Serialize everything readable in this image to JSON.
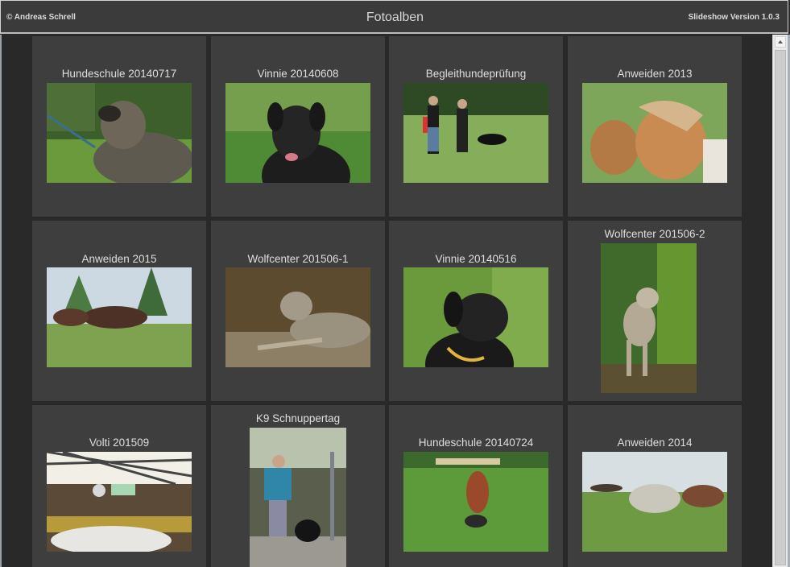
{
  "header": {
    "copyright": "© Andreas Schrell",
    "title": "Fotoalben",
    "version": "Slideshow Version 1.0.3"
  },
  "albums": [
    {
      "title": "Hundeschule 20140717",
      "icon": "dog-photo",
      "orientation": "landscape"
    },
    {
      "title": "Vinnie 20140608",
      "icon": "dog-photo",
      "orientation": "landscape"
    },
    {
      "title": "Begleithundeprüfung",
      "icon": "people-dog-photo",
      "orientation": "landscape"
    },
    {
      "title": "Anweiden 2013",
      "icon": "horse-photo",
      "orientation": "landscape"
    },
    {
      "title": "Anweiden 2015",
      "icon": "horse-photo",
      "orientation": "landscape"
    },
    {
      "title": "Wolfcenter 201506-1",
      "icon": "wolf-photo",
      "orientation": "landscape"
    },
    {
      "title": "Vinnie 20140516",
      "icon": "dog-photo",
      "orientation": "landscape"
    },
    {
      "title": "Wolfcenter 201506-2",
      "icon": "wolf-photo",
      "orientation": "portrait"
    },
    {
      "title": "Volti 201509",
      "icon": "vaulting-photo",
      "orientation": "landscape"
    },
    {
      "title": "K9 Schnuppertag",
      "icon": "person-dog-photo",
      "orientation": "portrait"
    },
    {
      "title": "Hundeschule 20140724",
      "icon": "dog-jump-photo",
      "orientation": "landscape"
    },
    {
      "title": "Anweiden 2014",
      "icon": "horse-photo",
      "orientation": "landscape"
    }
  ]
}
